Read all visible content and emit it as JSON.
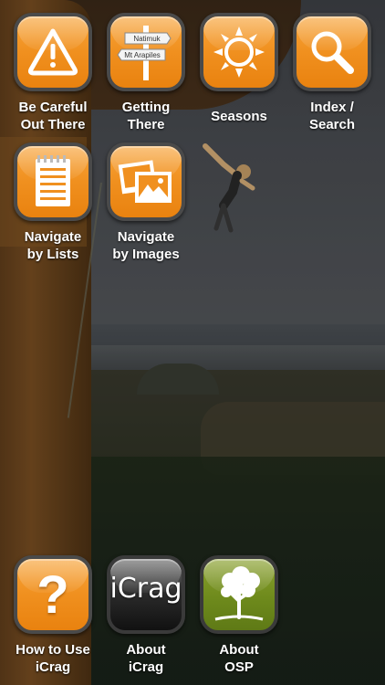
{
  "tiles": {
    "be_careful": {
      "line1": "Be Careful",
      "line2": "Out There",
      "icon": "warning-icon"
    },
    "getting_there": {
      "line1": "Getting",
      "line2": "There",
      "icon": "signpost-icon",
      "sign_top": "Natimuk",
      "sign_bottom": "Mt Arapiles"
    },
    "seasons": {
      "line1": "Seasons",
      "icon": "sun-icon"
    },
    "index_search": {
      "line1": "Index /",
      "line2": "Search",
      "icon": "search-icon"
    },
    "navigate_lists": {
      "line1": "Navigate",
      "line2": "by Lists",
      "icon": "notepad-icon"
    },
    "navigate_images": {
      "line1": "Navigate",
      "line2": "by Images",
      "icon": "photos-icon"
    },
    "how_to_use": {
      "line1": "How to Use",
      "line2": "iCrag",
      "icon": "question-icon",
      "glyph": "?"
    },
    "about_icrag": {
      "line1": "About",
      "line2": "iCrag",
      "logo_text": "iCrag"
    },
    "about_osp": {
      "line1": "About",
      "line2": "OSP",
      "icon": "tree-icon"
    }
  },
  "colors": {
    "orange": "#f0901f",
    "green": "#6e8a1c",
    "dark": "#2a2a2a"
  }
}
